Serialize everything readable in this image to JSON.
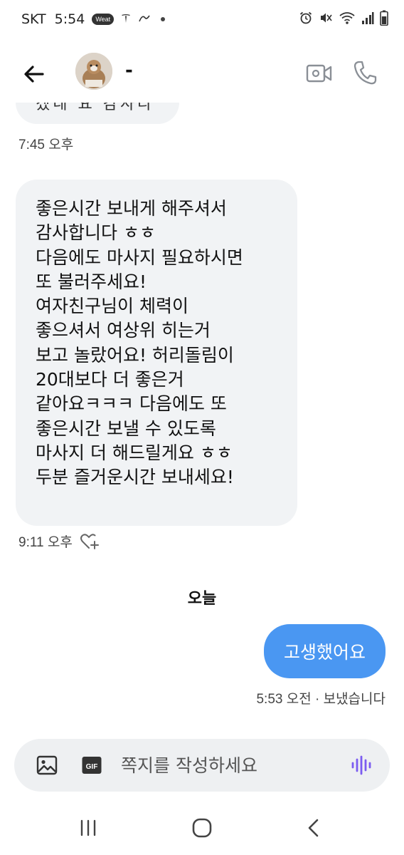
{
  "status_bar": {
    "carrier": "SKT",
    "time": "5:54",
    "badge": "Weat"
  },
  "header": {
    "contact_name": "-"
  },
  "messages": {
    "partial_text": "겠네 요 감사다",
    "ts_1": "7:45 오후",
    "long_lines": [
      "좋은시간 보내게 해주셔서",
      "감사합니다 ㅎㅎ",
      "다음에도 마사지 필요하시면",
      "또 불러주세요!",
      "여자친구님이 체력이",
      "좋으셔서 여상위 히는거",
      "보고 놀랐어요! 허리돌림이",
      "20대보다 더 좋은거",
      "같아요ㅋㅋㅋ 다음에도 또",
      "좋은시간 보낼 수 있도록",
      "마사지 더 해드릴게요 ㅎㅎ",
      "두분 즐거운시간 보내세요!"
    ],
    "ts_2": "9:11 오후",
    "date_separator": "오늘",
    "outgoing_text": "고생했어요",
    "ts_3": "5:53 오전 · 보냈습니다"
  },
  "composer": {
    "placeholder": "쪽지를 작성하세요",
    "gif_label": "GIF"
  },
  "colors": {
    "outgoing_bubble": "#4a97f2",
    "incoming_bubble": "#f1f3f5",
    "composer_bg": "#eef0f2",
    "voice_accent": "#7b5cf0"
  },
  "icons": {
    "back": "arrow-left-icon",
    "video": "video-camera-icon",
    "call": "phone-icon",
    "image": "image-icon",
    "gif": "gif-icon",
    "voice": "voice-wave-icon",
    "react": "heart-plus-icon"
  }
}
